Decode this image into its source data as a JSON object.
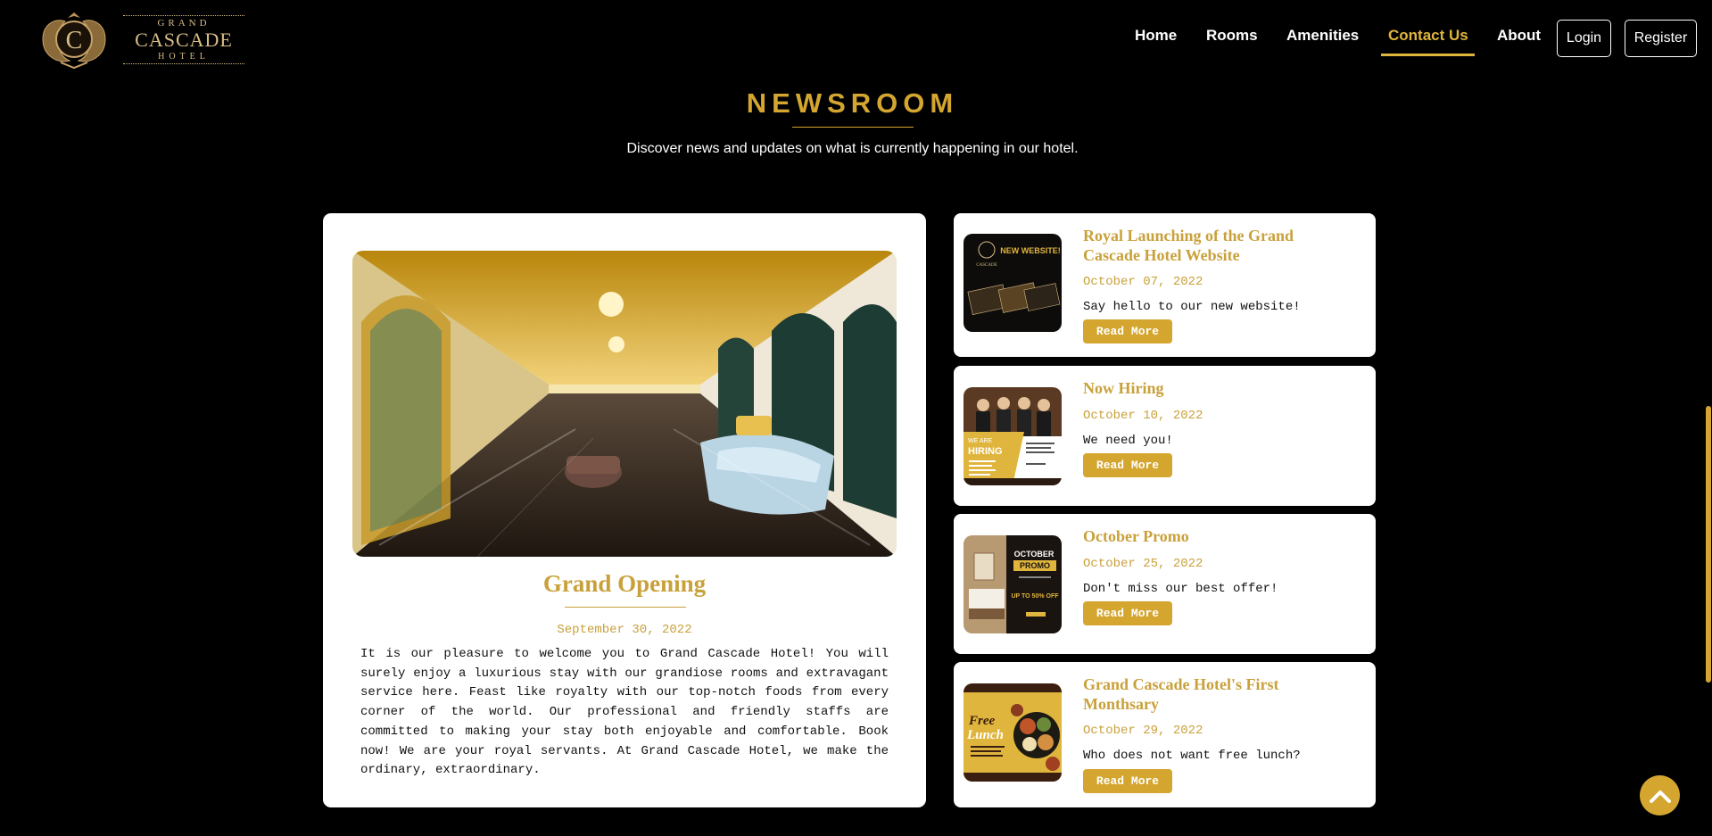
{
  "brand": {
    "line1": "GRAND",
    "line2": "CASCADE",
    "line3": "HOTEL",
    "monogram": "C",
    "accent": "#d4a62f"
  },
  "nav": {
    "links": [
      {
        "label": "Home"
      },
      {
        "label": "Rooms"
      },
      {
        "label": "Amenities"
      },
      {
        "label": "Contact Us",
        "active": true
      },
      {
        "label": "About"
      }
    ],
    "login": "Login",
    "register": "Register"
  },
  "section": {
    "title": "NEWSROOM",
    "subtitle": "Discover news and updates on what is currently happening in our hotel."
  },
  "featured": {
    "title": "Grand Opening",
    "date": "September 30, 2022",
    "body": "It is our pleasure to welcome you to Grand Cascade Hotel! You will surely enjoy a luxurious stay with our grandiose rooms and extravagant service here. Feast like royalty with our top-notch foods from every corner of the world. Our professional and friendly staffs are committed to making your stay both enjoyable and comfortable. Book now! We are your royal servants. At Grand Cascade Hotel, we make the ordinary, extraordinary."
  },
  "news": [
    {
      "title": "Royal Launching of the Grand Cascade Hotel Website",
      "date": "October 07, 2022",
      "text": "Say hello to our new website!",
      "button": "Read More",
      "thumb_text": "NEW WEBSITE!",
      "thumb_sub": "CASCADE"
    },
    {
      "title": "Now Hiring",
      "date": "October 10, 2022",
      "text": "We need you!",
      "button": "Read More",
      "thumb_text": "WE ARE",
      "thumb_sub": "HIRING"
    },
    {
      "title": "October Promo",
      "date": "October 25, 2022",
      "text": "Don't miss our best offer!",
      "button": "Read More",
      "thumb_text": "OCTOBER",
      "thumb_sub": "PROMO",
      "thumb_offer": "UP TO 50% OFF"
    },
    {
      "title": "Grand Cascade Hotel's First Monthsary",
      "date": "October 29, 2022",
      "text": "Who does not want free lunch?",
      "button": "Read More",
      "thumb_text": "Free",
      "thumb_sub": "Lunch"
    }
  ]
}
